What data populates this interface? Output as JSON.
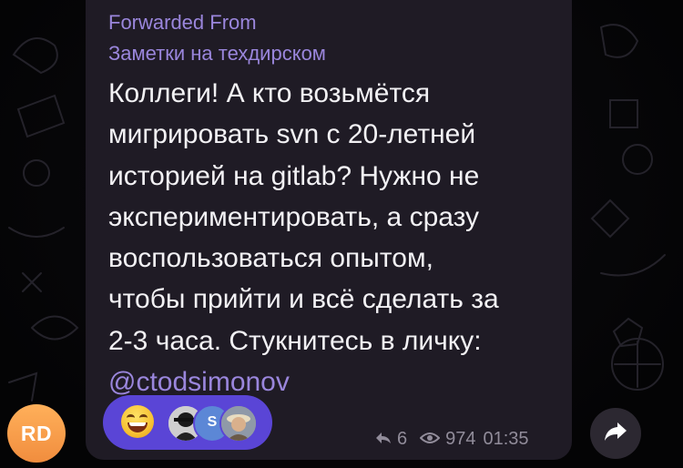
{
  "message": {
    "forwarded_label": "Forwarded From",
    "forwarded_source": "Заметки на техдирском",
    "lines": [
      "Коллеги! А кто возьмётся",
      "мигрировать svn с 20-летней",
      "историей на gitlab? Нужно не",
      "экспериментировать, а сразу",
      "воспользоваться опытом,",
      "чтобы прийти и всё сделать за",
      "2-3 часа. Стукнитесь в личку:"
    ],
    "mention": "@ctodsimonov"
  },
  "reactions": {
    "emoji": "grinning-face-icon",
    "avatars": [
      {
        "kind": "photo-bw"
      },
      {
        "kind": "letter",
        "letter": "S"
      },
      {
        "kind": "photo-color"
      }
    ]
  },
  "meta": {
    "replies": "6",
    "views": "974",
    "time": "01:35"
  },
  "sender_avatar": {
    "initials": "RD",
    "color": "#f39a48"
  },
  "colors": {
    "bubble": "#1f1b25",
    "accent": "#9a86dc",
    "reaction_pill": "#5a45d6",
    "meta_text": "#918c9a"
  }
}
